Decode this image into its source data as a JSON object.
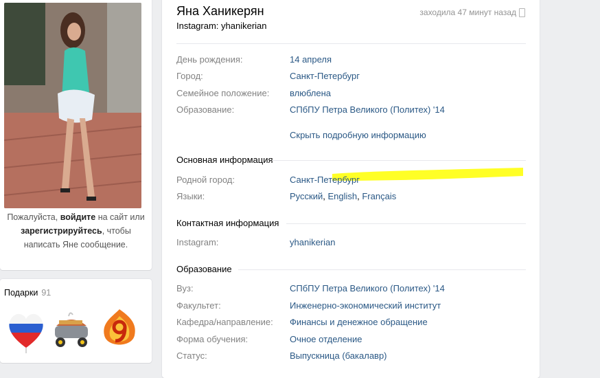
{
  "left": {
    "login_hint": {
      "part1": "Пожалуйста, ",
      "login": "войдите",
      "part2": " на сайт или",
      "register": "зарегистрируйтесь",
      "part3": ", чтобы",
      "part4": "написать Яне сообщение."
    },
    "gifts": {
      "label": "Подарки",
      "count": "91",
      "items": [
        {
          "icon": "heart-flag-icon"
        },
        {
          "icon": "bbq-grill-icon"
        },
        {
          "icon": "number-nine-fire-icon"
        }
      ]
    }
  },
  "profile": {
    "name": "Яна Ханикерян",
    "status": "Instagram: yhanikerian",
    "last_seen": "заходила 47 минут назад",
    "details": [
      {
        "label": "День рождения:",
        "value": "14 апреля"
      },
      {
        "label": "Город:",
        "value": "Санкт-Петербург"
      },
      {
        "label": "Семейное положение:",
        "value": "влюблена"
      },
      {
        "label": "Образование:",
        "value": "СПбПУ Петра Великого (Политех) '14"
      }
    ],
    "hide_details": "Скрыть подробную информацию",
    "main_info": {
      "title": "Основная информация",
      "hometown_label": "Родной город:",
      "hometown_value": "Санкт-Петербург",
      "languages_label": "Языки:",
      "languages": [
        "Русский",
        "English",
        "Français"
      ]
    },
    "contacts": {
      "title": "Контактная информация",
      "instagram_label": "Instagram:",
      "instagram_value": "yhanikerian"
    },
    "education": {
      "title": "Образование",
      "rows": [
        {
          "label": "Вуз:",
          "value": "СПбПУ Петра Великого (Политех) '14"
        },
        {
          "label": "Факультет:",
          "value": "Инженерно-экономический институт"
        },
        {
          "label": "Кафедра/направление:",
          "value": "Финансы и денежное обращение"
        },
        {
          "label": "Форма обучения:",
          "value": "Очное отделение"
        },
        {
          "label": "Статус:",
          "value": "Выпускница (бакалавр)"
        }
      ]
    }
  },
  "colors": {
    "link": "#2a5885",
    "label": "#828282",
    "highlight": "#ffff00"
  }
}
